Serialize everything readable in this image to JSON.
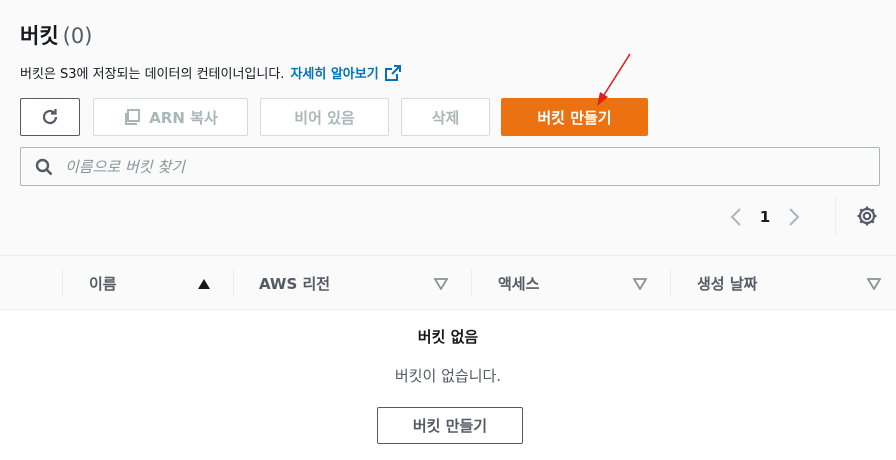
{
  "header": {
    "title": "버킷",
    "count": "(0)",
    "description": "버킷은 S3에 저장되는 데이터의 컨테이너입니다.",
    "learn_more": "자세히 알아보기"
  },
  "toolbar": {
    "refresh_icon": "refresh-icon",
    "copy_arn_label": "ARN 복사",
    "empty_label": "비어 있음",
    "delete_label": "삭제",
    "create_label": "버킷 만들기"
  },
  "search": {
    "placeholder": "이름으로 버킷 찾기",
    "value": ""
  },
  "pagination": {
    "current_page": "1"
  },
  "table": {
    "columns": [
      {
        "label": "이름",
        "sort": "ascending"
      },
      {
        "label": "AWS 리전",
        "sort": "none"
      },
      {
        "label": "액세스",
        "sort": "none"
      },
      {
        "label": "생성 날짜",
        "sort": "none"
      }
    ]
  },
  "empty_state": {
    "title": "버킷 없음",
    "message": "버킷이 없습니다.",
    "create_label": "버킷 만들기"
  },
  "colors": {
    "primary": "#ec7211",
    "link": "#0073bb",
    "text": "#16191f",
    "muted": "#545b64",
    "disabled": "#aab7b8",
    "annotation_arrow": "#e02020"
  }
}
